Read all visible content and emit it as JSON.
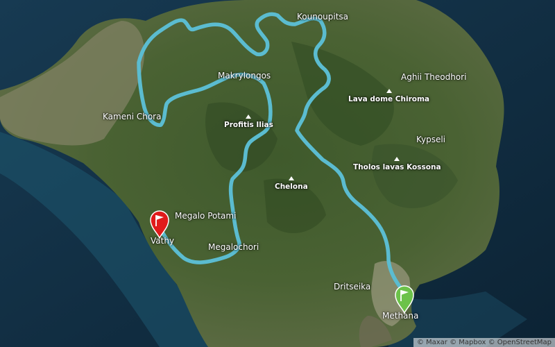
{
  "map": {
    "route_color": "#5bbcd0",
    "start_color": "#e01b1b",
    "end_color": "#6cc24a",
    "places": [
      {
        "id": "koundoupitsa",
        "label": "Kounoupitsa"
      },
      {
        "id": "makrylongos",
        "label": "Makrylongos"
      },
      {
        "id": "aghii",
        "label": "Aghii Theodhori"
      },
      {
        "id": "kameni",
        "label": "Kameni Chora"
      },
      {
        "id": "kypseli",
        "label": "Kypseli"
      },
      {
        "id": "megalo-potami",
        "label": "Megalo Potami"
      },
      {
        "id": "vathy",
        "label": "Vathy"
      },
      {
        "id": "megalochori",
        "label": "Megalochori"
      },
      {
        "id": "dritseika",
        "label": "Dritseika"
      },
      {
        "id": "methana",
        "label": "Methana"
      }
    ],
    "peaks": [
      {
        "id": "lava-dome",
        "label": "Lava dome Chiroma"
      },
      {
        "id": "profitis",
        "label": "Profitis Ilias"
      },
      {
        "id": "tholos",
        "label": "Tholos lavas Kossona"
      },
      {
        "id": "chelona",
        "label": "Chelona"
      }
    ],
    "markers": {
      "start_icon": "flag-marker-icon",
      "end_icon": "flag-marker-icon"
    },
    "attribution": "© Maxar © Mapbox © OpenStreetMap"
  }
}
